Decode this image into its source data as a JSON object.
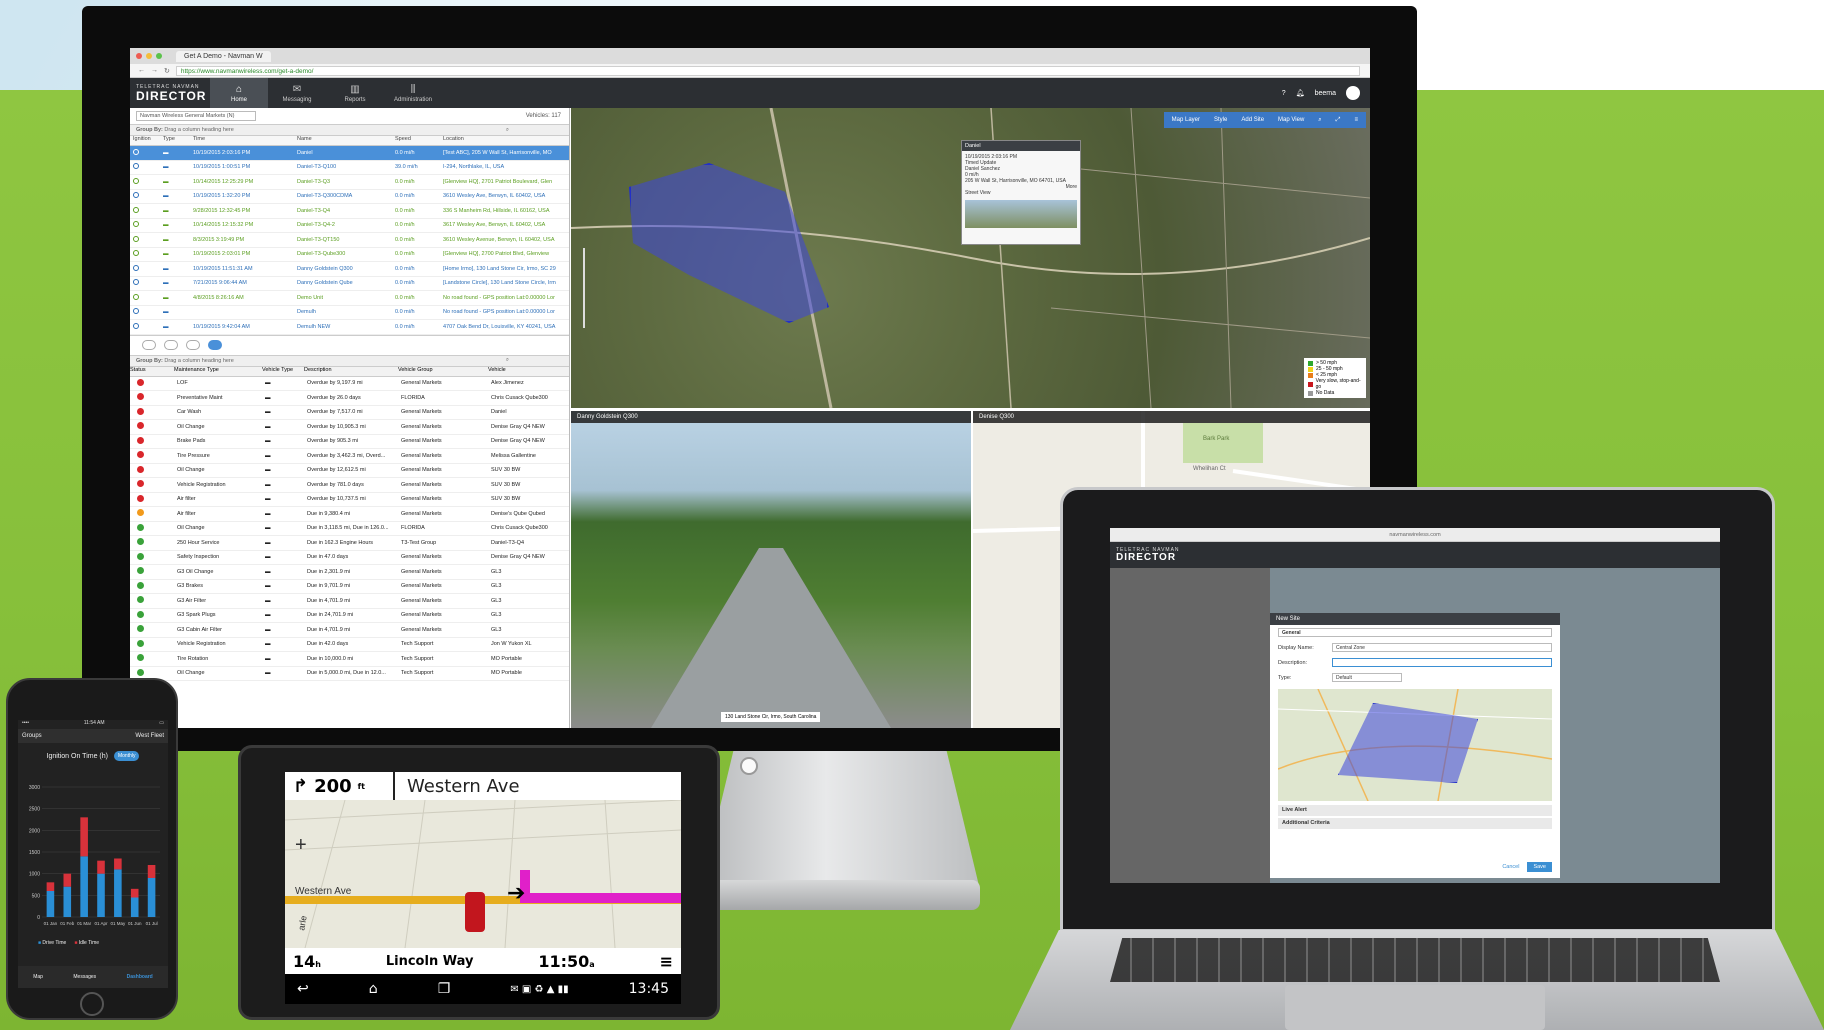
{
  "monitor": {
    "browser": {
      "tab_title": "Get A Demo - Navman W",
      "url": "https://www.navmanwireless.com/get-a-demo/"
    },
    "app": {
      "logo_top": "TELETRAC NAVMAN",
      "logo_main": "DIRECTOR",
      "nav": [
        {
          "label": "Home",
          "icon": "home-icon"
        },
        {
          "label": "Messaging",
          "icon": "envelope-icon"
        },
        {
          "label": "Reports",
          "icon": "bar-chart-icon"
        },
        {
          "label": "Administration",
          "icon": "sliders-icon"
        }
      ],
      "user": "beema"
    },
    "vehicles": {
      "group_select": "Navman Wireless General Markets (N)",
      "count": "Vehicles: 117",
      "group_by": "Group By:",
      "group_by_hint": "Drag a column heading here",
      "columns": [
        "Ignition",
        "Type",
        "Time",
        "Name",
        "Speed",
        "Location"
      ],
      "rows": [
        {
          "time": "10/19/2015 2:03:16 PM",
          "name": "Daniel",
          "speed": "0.0 mi/h",
          "location": "[Test ABC], 205 W Wall St, Harrisonville, MO",
          "style": "sel"
        },
        {
          "time": "10/19/2015 1:00:51 PM",
          "name": "Daniel-T3-Q100",
          "speed": "39.0 mi/h",
          "location": "I-294, Northlake, IL, USA",
          "style": "blue"
        },
        {
          "time": "10/14/2015 12:25:29 PM",
          "name": "Daniel-T3-Q3",
          "speed": "0.0 mi/h",
          "location": "[Glenview HQ], 2701 Patriot Boulevard, Glen",
          "style": "green"
        },
        {
          "time": "10/19/2015 1:32:20 PM",
          "name": "Daniel-T3-Q300CDMA",
          "speed": "0.0 mi/h",
          "location": "3610 Wesley Ave, Berwyn, IL 60402, USA",
          "style": "blue"
        },
        {
          "time": "9/28/2015 12:32:45 PM",
          "name": "Daniel-T3-Q4",
          "speed": "0.0 mi/h",
          "location": "336 S Manheim Rd, Hillside, IL 60162, USA",
          "style": "green"
        },
        {
          "time": "10/14/2015 12:15:32 PM",
          "name": "Daniel-T3-Q4-2",
          "speed": "0.0 mi/h",
          "location": "3617 Wesley Ave, Berwyn, IL 60402, USA",
          "style": "green"
        },
        {
          "time": "8/3/2015 3:19:49 PM",
          "name": "Daniel-T3-QT150",
          "speed": "0.0 mi/h",
          "location": "3610 Wesley Avenue, Berwyn, IL 60402, USA",
          "style": "green"
        },
        {
          "time": "10/19/2015 2:03:01 PM",
          "name": "Daniel-T3-Qube300",
          "speed": "0.0 mi/h",
          "location": "[Glenview HQ], 2700 Patriot Blvd, Glenview",
          "style": "green"
        },
        {
          "time": "10/19/2015 11:51:31 AM",
          "name": "Danny Goldstein Q300",
          "speed": "0.0 mi/h",
          "location": "[Home Irmo], 130 Land Stone Cir, Irmo, SC 29",
          "style": "blue"
        },
        {
          "time": "7/21/2015 9:06:44 AM",
          "name": "Danny Goldstein Qube",
          "speed": "0.0 mi/h",
          "location": "[Landstone Circle], 130 Land Stone Circle, Irm",
          "style": "blue"
        },
        {
          "time": "4/8/2015 8:26:16 AM",
          "name": "Demo Unit",
          "speed": "0.0 mi/h",
          "location": "No road found - GPS position Lat:0.00000 Lor",
          "style": "green"
        },
        {
          "time": "",
          "name": "Demulh",
          "speed": "0.0 mi/h",
          "location": "No road found - GPS position Lat:0.00000 Lor",
          "style": "blue"
        },
        {
          "time": "10/19/2015 9:42:04 AM",
          "name": "Demulh NEW",
          "speed": "0.0 mi/h",
          "location": "4707 Oak Bend Dr, Louisville, KY 40241, USA",
          "style": "blue"
        }
      ]
    },
    "maintenance": {
      "group_by": "Group By:",
      "group_by_hint": "Drag a column heading here",
      "columns": [
        "Status",
        "Maintenance Type",
        "Vehicle Type",
        "Description",
        "Vehicle Group",
        "Vehicle"
      ],
      "rows": [
        {
          "status": "red",
          "type": "LOF",
          "desc": "Overdue by 9,197.9 mi",
          "group": "General Markets",
          "vehicle": "Alex Jimenez"
        },
        {
          "status": "red",
          "type": "Preventative Maint",
          "desc": "Overdue by 26.0 days",
          "group": "FLORIDA",
          "vehicle": "Chris Cusack Qube300"
        },
        {
          "status": "red",
          "type": "Car Wash",
          "desc": "Overdue by 7,517.0 mi",
          "group": "General Markets",
          "vehicle": "Daniel"
        },
        {
          "status": "red",
          "type": "Oil Change",
          "desc": "Overdue by 10,905.3 mi",
          "group": "General Markets",
          "vehicle": "Denise Gray Q4 NEW"
        },
        {
          "status": "red",
          "type": "Brake Pads",
          "desc": "Overdue by 905.3 mi",
          "group": "General Markets",
          "vehicle": "Denise Gray Q4 NEW"
        },
        {
          "status": "red",
          "type": "Tire Pressure",
          "desc": "Overdue by 3,462.3 mi, Overd...",
          "group": "General Markets",
          "vehicle": "Melissa Gallentine"
        },
        {
          "status": "red",
          "type": "Oil Change",
          "desc": "Overdue by 12,612.5 mi",
          "group": "General Markets",
          "vehicle": "SUV 30 BW"
        },
        {
          "status": "red",
          "type": "Vehicle Registration",
          "desc": "Overdue by 781.0 days",
          "group": "General Markets",
          "vehicle": "SUV 30 BW"
        },
        {
          "status": "red",
          "type": "Air filter",
          "desc": "Overdue by 10,737.5 mi",
          "group": "General Markets",
          "vehicle": "SUV 30 BW"
        },
        {
          "status": "orange",
          "type": "Air filter",
          "desc": "Due in 9,380.4 mi",
          "group": "General Markets",
          "vehicle": "Denise's Qube Qubed"
        },
        {
          "status": "green",
          "type": "Oil Change",
          "desc": "Due in 3,118.5 mi, Due in 126.0...",
          "group": "FLORIDA",
          "vehicle": "Chris Cusack Qube300"
        },
        {
          "status": "green",
          "type": "250 Hour Service",
          "desc": "Due in 162.3 Engine Hours",
          "group": "T3-Test Group",
          "vehicle": "Daniel-T3-Q4"
        },
        {
          "status": "green",
          "type": "Safety Inspection",
          "desc": "Due in 47.0 days",
          "group": "General Markets",
          "vehicle": "Denise Gray Q4 NEW"
        },
        {
          "status": "green",
          "type": "G3 Oil Change",
          "desc": "Due in 2,301.9 mi",
          "group": "General Markets",
          "vehicle": "GL3"
        },
        {
          "status": "green",
          "type": "G3 Brakes",
          "desc": "Due in 9,701.9 mi",
          "group": "General Markets",
          "vehicle": "GL3"
        },
        {
          "status": "green",
          "type": "G3 Air Filter",
          "desc": "Due in 4,701.9 mi",
          "group": "General Markets",
          "vehicle": "GL3"
        },
        {
          "status": "green",
          "type": "G3 Spark Plugs",
          "desc": "Due in 24,701.9 mi",
          "group": "General Markets",
          "vehicle": "GL3"
        },
        {
          "status": "green",
          "type": "G3 Cabin Air Filter",
          "desc": "Due in 4,701.9 mi",
          "group": "General Markets",
          "vehicle": "GL3"
        },
        {
          "status": "green",
          "type": "Vehicle Registration",
          "desc": "Due in 42.0 days",
          "group": "Tech Support",
          "vehicle": "Jon W Yukon XL"
        },
        {
          "status": "green",
          "type": "Tire Rotation",
          "desc": "Due in 10,000.0 mi",
          "group": "Tech Support",
          "vehicle": "MO Portable"
        },
        {
          "status": "green",
          "type": "Oil Change",
          "desc": "Due in 5,000.0 mi, Due in 12.0...",
          "group": "Tech Support",
          "vehicle": "MO Portable"
        }
      ]
    },
    "map": {
      "toolbar": [
        "Map Layer",
        "Style",
        "Add Site",
        "Map View"
      ],
      "popup": {
        "title": "Daniel",
        "time": "10/19/2015 2:03:16 PM",
        "update": "Timed Update",
        "driver": "Daniel Sanchez",
        "speed": "0 mi/h",
        "address": "205 W Wall St, Harrisonville, MO 64701, USA",
        "more": "More",
        "street_view": "Street View"
      },
      "legend": [
        "> 50 mph",
        "25 - 50 mph",
        "< 25 mph",
        "Very slow, stop-and-go",
        "No Data"
      ],
      "legend_colors": [
        "#2ea82e",
        "#f0d21b",
        "#e87d1a",
        "#c8161d",
        "#999999"
      ]
    },
    "street_view": {
      "title": "Danny Goldstein Q300",
      "caption": "130 Land Stone Cir, Irmo, South Carolina"
    },
    "mini_map": {
      "title": "Denise Q300",
      "labels": [
        "Bark Park",
        "Whelihan Ct"
      ]
    }
  },
  "phone": {
    "carrier": "•••• ",
    "time": "11:54 AM",
    "groups": "Groups",
    "fleet": "West Fleet",
    "chart_title": "Ignition On Time (h)",
    "toggle": "Monthly",
    "legend": [
      "Drive Time",
      "Idle Time"
    ],
    "tabs": [
      "Map",
      "Messages",
      "Dashboard"
    ],
    "chart_data": {
      "type": "bar",
      "categories": [
        "01 Jan",
        "01 Feb",
        "01 Mar",
        "01 Apr",
        "01 May",
        "01 Jun",
        "01 Jul"
      ],
      "ylim": [
        0,
        3000
      ],
      "yticks": [
        "0",
        "500",
        "1000",
        "1500",
        "2000",
        "2500",
        "3000"
      ],
      "series": [
        {
          "name": "Drive Time",
          "color": "#2a8fd6",
          "values": [
            600,
            700,
            1400,
            1000,
            1100,
            450,
            900
          ]
        },
        {
          "name": "Idle Time",
          "color": "#d8323b",
          "values": [
            200,
            300,
            900,
            300,
            250,
            200,
            300
          ]
        }
      ]
    }
  },
  "gps": {
    "distance": "200",
    "distance_unit": "ft",
    "street": "Western Ave",
    "map_label_street": "Western Ave",
    "map_label_side": "arle",
    "eta": "14",
    "eta_unit": "h",
    "next_road": "Lincoln Way",
    "arrival": "11:50",
    "arrival_unit": "a",
    "clock": "13:45"
  },
  "laptop": {
    "url": "navmanwireless.com",
    "logo_top": "TELETRAC NAVMAN",
    "logo_main": "DIRECTOR",
    "dialog": {
      "title": "New Site",
      "category": "General",
      "display_name_label": "Display Name:",
      "display_name_value": "Central Zone",
      "description_label": "Description:",
      "type_label": "Type:",
      "type_value": "Default",
      "live_alert": "Live Alert",
      "additional_criteria": "Additional Criteria",
      "cancel": "Cancel",
      "save": "Save"
    }
  }
}
